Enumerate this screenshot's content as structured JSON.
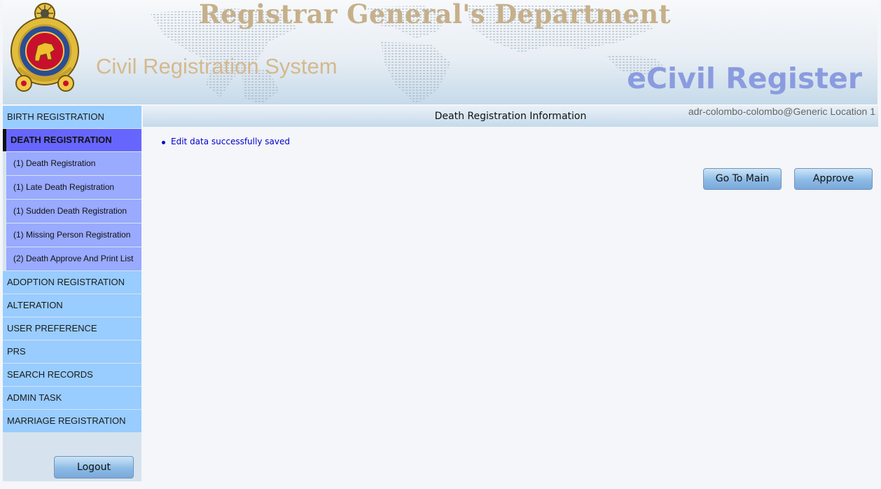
{
  "header": {
    "department_title": "Registrar General's Department",
    "system_title": "Civil Registration System",
    "brand": "eCivil Register"
  },
  "sidebar": {
    "birth_registration": "BIRTH REGISTRATION",
    "death_registration": "DEATH REGISTRATION",
    "death_subitems": [
      "(1) Death Registration",
      "(1) Late Death Registration",
      "(1) Sudden Death Registration",
      "(1) Missing Person Registration",
      "(2) Death Approve And Print List"
    ],
    "adoption_registration": "ADOPTION REGISTRATION",
    "alteration": "ALTERATION",
    "user_preference": "USER PREFERENCE",
    "prs": "PRS",
    "search_records": "SEARCH RECORDS",
    "admin_task": "ADMIN TASK",
    "marriage_registration": "MARRIAGE REGISTRATION",
    "logout_label": "Logout"
  },
  "main": {
    "title": "Death Registration Information",
    "user_info": "adr-colombo-colombo@Generic Location 1",
    "messages": [
      "Edit data successfully saved"
    ],
    "go_to_main_label": "Go To Main",
    "approve_label": "Approve"
  },
  "colors": {
    "menu": "#99ccff",
    "menu_active": "#6666ff",
    "submenu": "#99aaff",
    "brand": "#8a9cdf"
  }
}
